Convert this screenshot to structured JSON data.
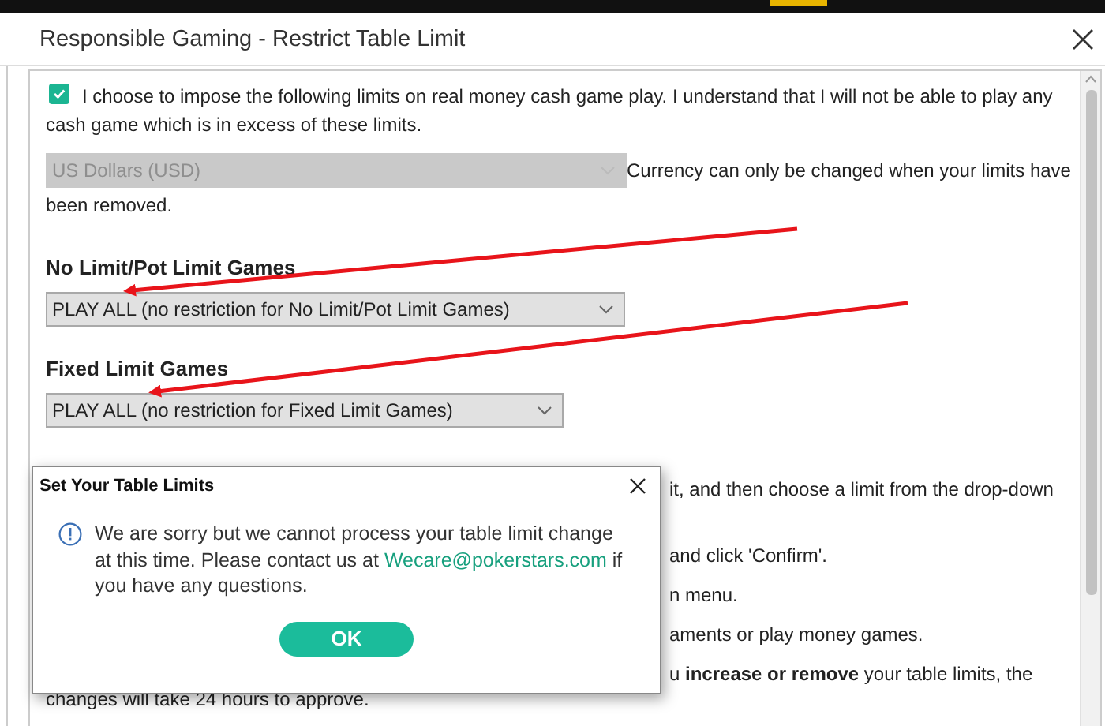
{
  "window": {
    "title": "Responsible Gaming - Restrict Table Limit"
  },
  "consent": {
    "checked": true,
    "text": "I choose to impose the following limits on real money cash game play. I understand that I will not be able to play any cash game which is in excess of these limits."
  },
  "currency": {
    "value": "US Dollars (USD)",
    "disabled": true,
    "note_lines": [
      "Currency can only be changed when your limits have",
      "been removed."
    ]
  },
  "limit_sections": [
    {
      "heading": "No Limit/Pot Limit Games",
      "value": "PLAY ALL (no restriction for No Limit/Pot Limit Games)"
    },
    {
      "heading": "Fixed Limit Games",
      "value": "PLAY ALL (no restriction for Fixed Limit Games)"
    }
  ],
  "instructions_visible_ends": [
    "it, and then choose a limit from the drop-down",
    "and click 'Confirm'.",
    "n menu.",
    "aments or play money games.",
    "u **increase or remove** your table limits, the"
  ],
  "instructions_last_line": "changes will take 24 hours to approve.",
  "dialog": {
    "title": "Set Your Table Limits",
    "message_before": "We are sorry but we cannot process your table limit change at this time. Please contact us at ",
    "link": "Wecare@pokerstars.com",
    "message_after": " if you have any questions.",
    "button": "OK"
  }
}
